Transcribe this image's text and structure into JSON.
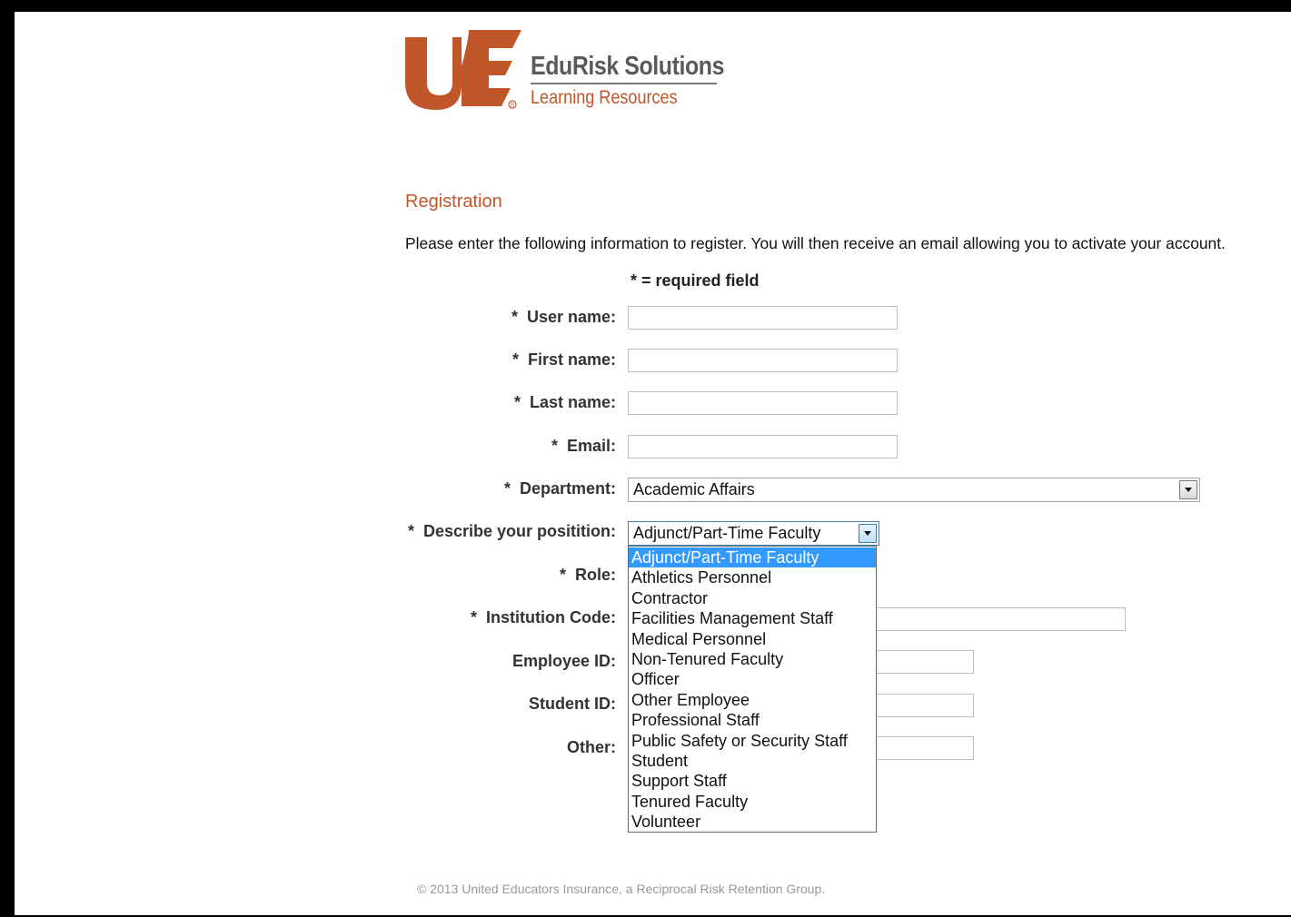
{
  "brand": {
    "name": "EduRisk Solutions",
    "tagline": "Learning Resources",
    "primary_color": "#c0572a"
  },
  "page": {
    "title": "Registration",
    "intro": "Please enter the following information to register. You will then receive an email allowing you to activate your account.",
    "required_note": "* = required field"
  },
  "form": {
    "required_marker": "*",
    "fields": {
      "username": {
        "label": "User name:",
        "value": ""
      },
      "first_name": {
        "label": "First name:",
        "value": ""
      },
      "last_name": {
        "label": "Last name:",
        "value": ""
      },
      "email": {
        "label": "Email:",
        "value": ""
      },
      "department": {
        "label": "Department:",
        "value": "Academic Affairs"
      },
      "position": {
        "label": "Describe your positition:",
        "value": "Adjunct/Part-Time Faculty"
      },
      "role": {
        "label": "Role:",
        "value": ""
      },
      "institution_code": {
        "label": "Institution Code:",
        "value": ""
      },
      "employee_id": {
        "label": "Employee ID:",
        "value": ""
      },
      "student_id": {
        "label": "Student ID:",
        "value": ""
      },
      "other": {
        "label": "Other:",
        "value": ""
      }
    },
    "position_options": [
      "Adjunct/Part-Time Faculty",
      "Athletics Personnel",
      "Contractor",
      "Facilities Management Staff",
      "Medical Personnel",
      "Non-Tenured Faculty",
      "Officer",
      "Other Employee",
      "Professional Staff",
      "Public Safety or Security Staff",
      "Student",
      "Support Staff",
      "Tenured Faculty",
      "Volunteer"
    ],
    "position_selected_index": 0
  },
  "footer": {
    "copyright": "© 2013 United Educators Insurance, a Reciprocal Risk Retention Group."
  }
}
